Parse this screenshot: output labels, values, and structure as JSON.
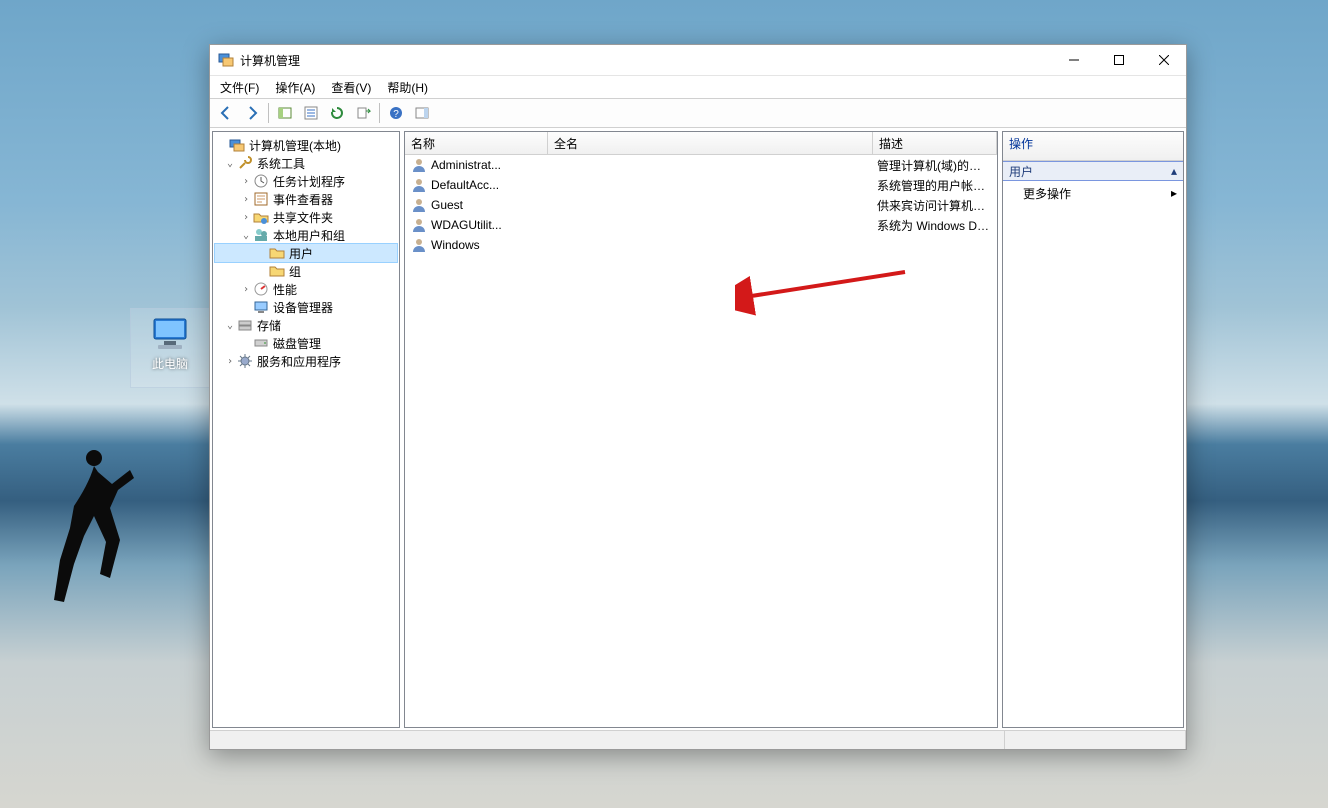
{
  "desktop": {
    "this_pc_label": "此电脑"
  },
  "window": {
    "title": "计算机管理"
  },
  "menus": {
    "file": "文件(F)",
    "action": "操作(A)",
    "view": "查看(V)",
    "help": "帮助(H)"
  },
  "toolbar": {
    "back": "back",
    "forward": "forward",
    "up": "up",
    "props": "properties",
    "refresh": "refresh",
    "export": "export",
    "help": "help"
  },
  "tree": {
    "root": "计算机管理(本地)",
    "system_tools": "系统工具",
    "task_scheduler": "任务计划程序",
    "event_viewer": "事件查看器",
    "shared_folders": "共享文件夹",
    "local_users_groups": "本地用户和组",
    "users": "用户",
    "groups": "组",
    "performance": "性能",
    "device_manager": "设备管理器",
    "storage": "存储",
    "disk_management": "磁盘管理",
    "services_apps": "服务和应用程序"
  },
  "list": {
    "columns": {
      "name": "名称",
      "fullname": "全名",
      "description": "描述"
    },
    "rows": [
      {
        "name": "Administrat...",
        "fullname": "",
        "description": "管理计算机(域)的内置帐户"
      },
      {
        "name": "DefaultAcc...",
        "fullname": "",
        "description": "系统管理的用户帐户。"
      },
      {
        "name": "Guest",
        "fullname": "",
        "description": "供来宾访问计算机或访问域的内..."
      },
      {
        "name": "WDAGUtilit...",
        "fullname": "",
        "description": "系统为 Windows Defender 应用..."
      },
      {
        "name": "Windows",
        "fullname": "",
        "description": ""
      }
    ]
  },
  "actions": {
    "header": "操作",
    "section": "用户",
    "more": "更多操作"
  }
}
